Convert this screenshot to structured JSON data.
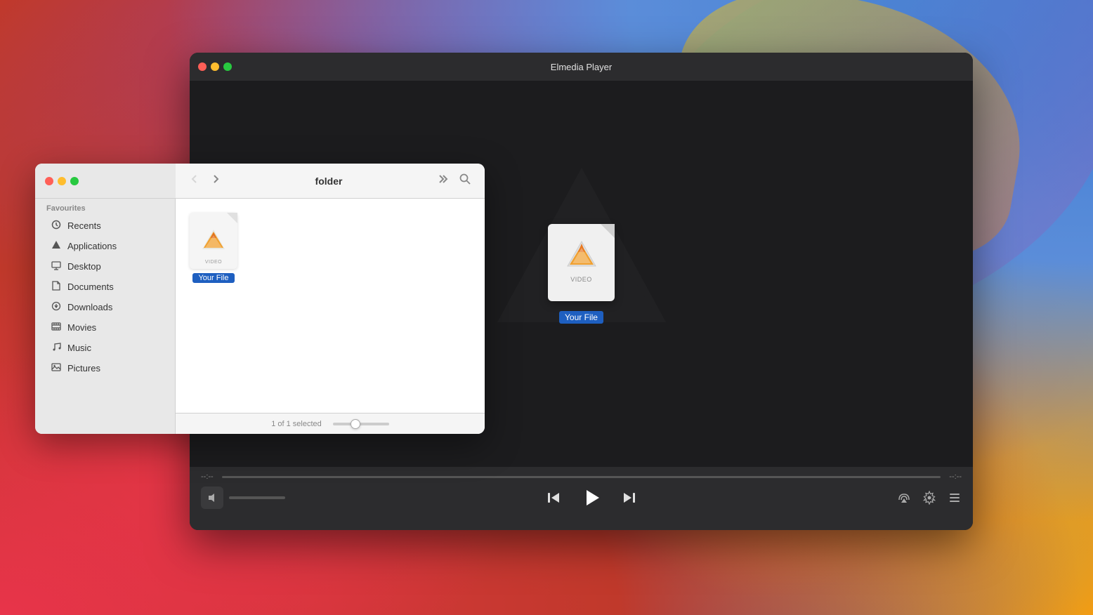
{
  "wallpaper": {
    "alt": "macOS Big Sur wallpaper"
  },
  "mediaPlayer": {
    "title": "Elmedia Player",
    "trafficLights": [
      "close",
      "minimize",
      "maximize"
    ],
    "fileCard": {
      "label": "VIDEO",
      "fileName": "Your File"
    },
    "progressBar": {
      "currentTime": "--:--",
      "endTime": "--:--"
    },
    "controls": {
      "previous": "⏮",
      "play": "▶",
      "next": "⏭",
      "airplay": "⊙",
      "settings": "⚙",
      "playlist": "☰"
    }
  },
  "finderWindow": {
    "trafficLights": [
      "close",
      "minimize",
      "maximize"
    ],
    "toolbar": {
      "backBtn": "<",
      "forwardBtn": ">",
      "pathLabel": "folder",
      "chevron": ">>",
      "searchIcon": "🔍"
    },
    "sidebar": {
      "sectionLabel": "Favourites",
      "items": [
        {
          "label": "Recents",
          "icon": "⊙"
        },
        {
          "label": "Applications",
          "icon": "✦"
        },
        {
          "label": "Desktop",
          "icon": "▭"
        },
        {
          "label": "Documents",
          "icon": "📄"
        },
        {
          "label": "Downloads",
          "icon": "⊙"
        },
        {
          "label": "Movies",
          "icon": "▣"
        },
        {
          "label": "Music",
          "icon": "♪"
        },
        {
          "label": "Pictures",
          "icon": "🖼"
        }
      ]
    },
    "content": {
      "files": [
        {
          "name": "Your File",
          "type": "VIDEO"
        }
      ]
    },
    "statusBar": {
      "selectionText": "1 of 1 selected"
    }
  }
}
